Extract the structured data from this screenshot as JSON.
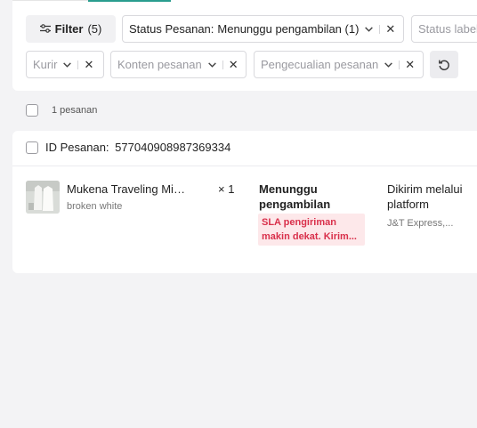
{
  "filters": {
    "filter_button_label": "Filter",
    "filter_button_count": "(5)",
    "status_chip_label": "Status Pesanan:",
    "status_chip_value": "Menunggu pengambilan (1)",
    "status_label_placeholder": "Status label",
    "kurir_placeholder": "Kurir",
    "konten_placeholder": "Konten pesanan",
    "pengecualian_placeholder": "Pengecualian pesanan"
  },
  "list": {
    "count_text": "1 pesanan"
  },
  "order": {
    "id_label": "ID Pesanan:",
    "id_value": "577040908987369334",
    "product_name": "Mukena Traveling Mini...",
    "product_variant": "broken white",
    "quantity": "× 1",
    "status": "Menunggu pengambilan",
    "sla_warning": "SLA pengiriman makin dekat. Kirim...",
    "shipping_method": "Dikirim melalui platform",
    "shipping_carrier": "J&T Express,..."
  },
  "colors": {
    "accent": "#2a9d8f",
    "sla_text": "#d9304b",
    "sla_bg": "#fde8ea"
  }
}
